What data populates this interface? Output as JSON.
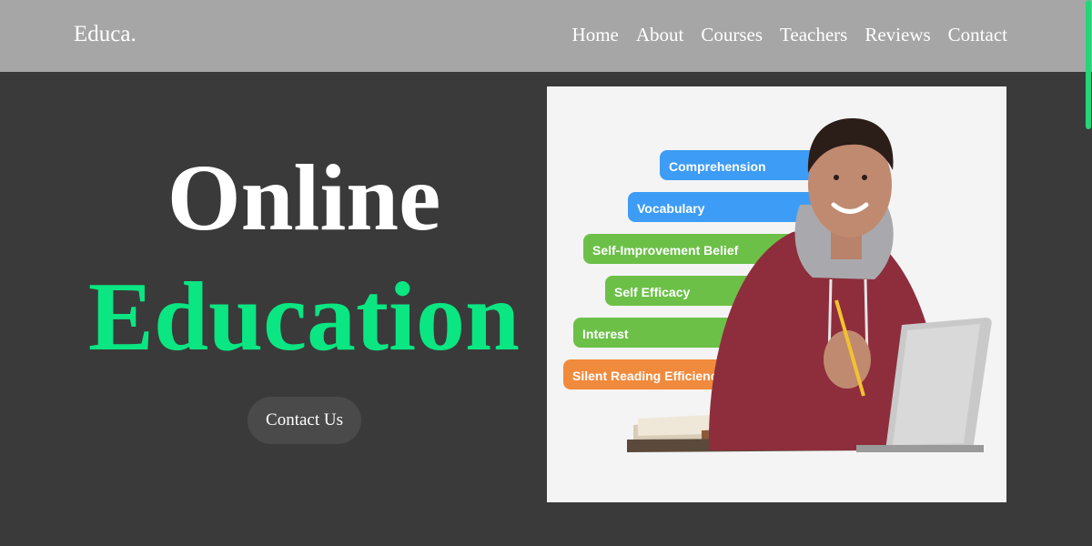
{
  "header": {
    "logo": "Educa.",
    "nav": [
      "Home",
      "About",
      "Courses",
      "Teachers",
      "Reviews",
      "Contact"
    ]
  },
  "hero": {
    "title_line1": "Online",
    "title_line2": "Education",
    "cta_label": "Contact Us",
    "image": {
      "skill_labels": [
        "Comprehension",
        "Vocabulary",
        "Self-Improvement Belief",
        "Self Efficacy",
        "Interest",
        "Silent Reading Efficiency"
      ]
    }
  },
  "colors": {
    "nav_background": "#a6a6a6",
    "page_background": "#3a3a3a",
    "accent": "#0ae682",
    "label_blue": "#3d9cf5",
    "label_green": "#6cc048",
    "label_orange": "#f08a3c"
  }
}
